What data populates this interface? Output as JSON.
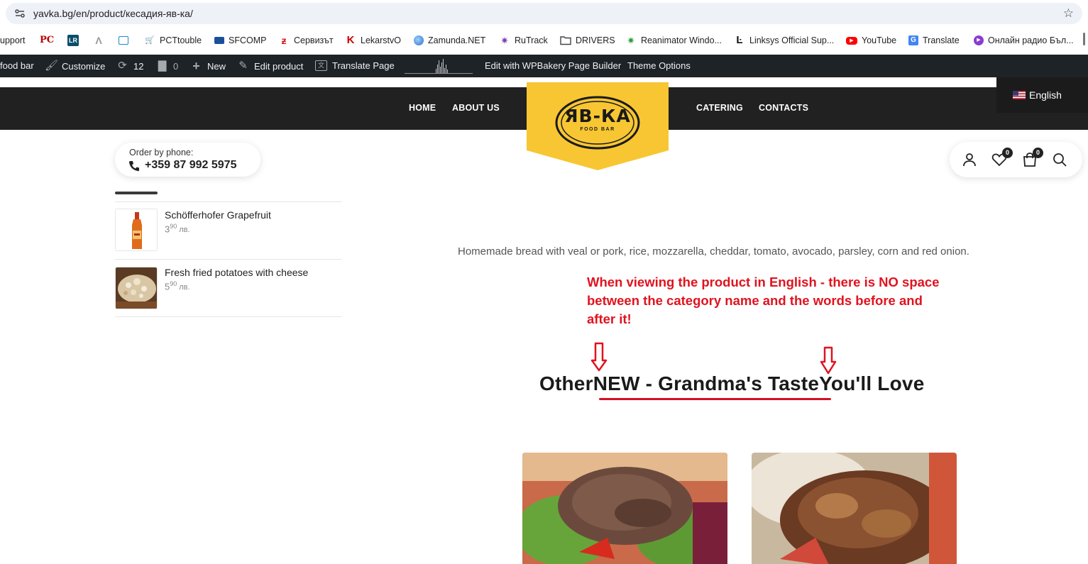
{
  "browser": {
    "url": "yavka.bg/en/product/кесадия-яв-ка/",
    "bookmarks": [
      {
        "label": "upport",
        "icon": "none"
      },
      {
        "label": "",
        "icon": "pc-icon"
      },
      {
        "label": "",
        "icon": "lr-icon"
      },
      {
        "label": "",
        "icon": "lambda-icon"
      },
      {
        "label": "",
        "icon": "image-icon"
      },
      {
        "label": "PCTtouble",
        "icon": "cart-icon"
      },
      {
        "label": "SFCOMP",
        "icon": "sfcomp-icon"
      },
      {
        "label": "Сервизът",
        "icon": "zigzag-icon"
      },
      {
        "label": "LekarstvO",
        "icon": "k-icon"
      },
      {
        "label": "Zamunda.NET",
        "icon": "globe-icon"
      },
      {
        "label": "RuTrack",
        "icon": "star-burst-icon"
      },
      {
        "label": "DRIVERS",
        "icon": "folder-icon"
      },
      {
        "label": "Reanimator Windo...",
        "icon": "star-burst-icon"
      },
      {
        "label": "Linksys Official Sup...",
        "icon": "linksys-icon"
      },
      {
        "label": "YouTube",
        "icon": "youtube-icon"
      },
      {
        "label": "Translate",
        "icon": "translate-icon"
      },
      {
        "label": "Онлайн радио Бъл...",
        "icon": "radio-icon"
      }
    ]
  },
  "adminbar": {
    "site": "food bar",
    "customize": "Customize",
    "updates": "12",
    "comments": "0",
    "new": "New",
    "edit_product": "Edit product",
    "translate_page": "Translate Page",
    "wpbakery": "Edit with WPBakery Page Builder",
    "theme_options": "Theme Options"
  },
  "nav": {
    "home": "HOME",
    "about": "ABOUT US",
    "catering": "CATERING",
    "contacts": "CONTACTS",
    "logo_text": "ЯВ-КА",
    "logo_sub": "FOOD BAR",
    "language": "English"
  },
  "order": {
    "label": "Order by phone:",
    "phone": "+359 87 992 5975"
  },
  "header_icons": {
    "wishlist_count": "0",
    "cart_count": "0"
  },
  "sidebar_products": [
    {
      "name": "Schöfferhofer Grapefruit",
      "price_main": "3",
      "price_dec": "90",
      "currency": "лв."
    },
    {
      "name": "Fresh fried potatoes with cheese",
      "price_main": "5",
      "price_dec": "90",
      "currency": "лв."
    }
  ],
  "product": {
    "description": "Homemade bread with veal or pork, rice, mozzarella, cheddar, tomato, avocado, parsley, corn and red onion.",
    "annotation": "When viewing the product in English - there is NO space between the category name and the words before and after it!",
    "heading_before": "Other",
    "heading_category": "NEW - Grandma's Taste",
    "heading_after": "You'll Love"
  },
  "colors": {
    "brand_yellow": "#f7c632",
    "header_dark": "#212121",
    "annotation_red": "#e0131f"
  }
}
